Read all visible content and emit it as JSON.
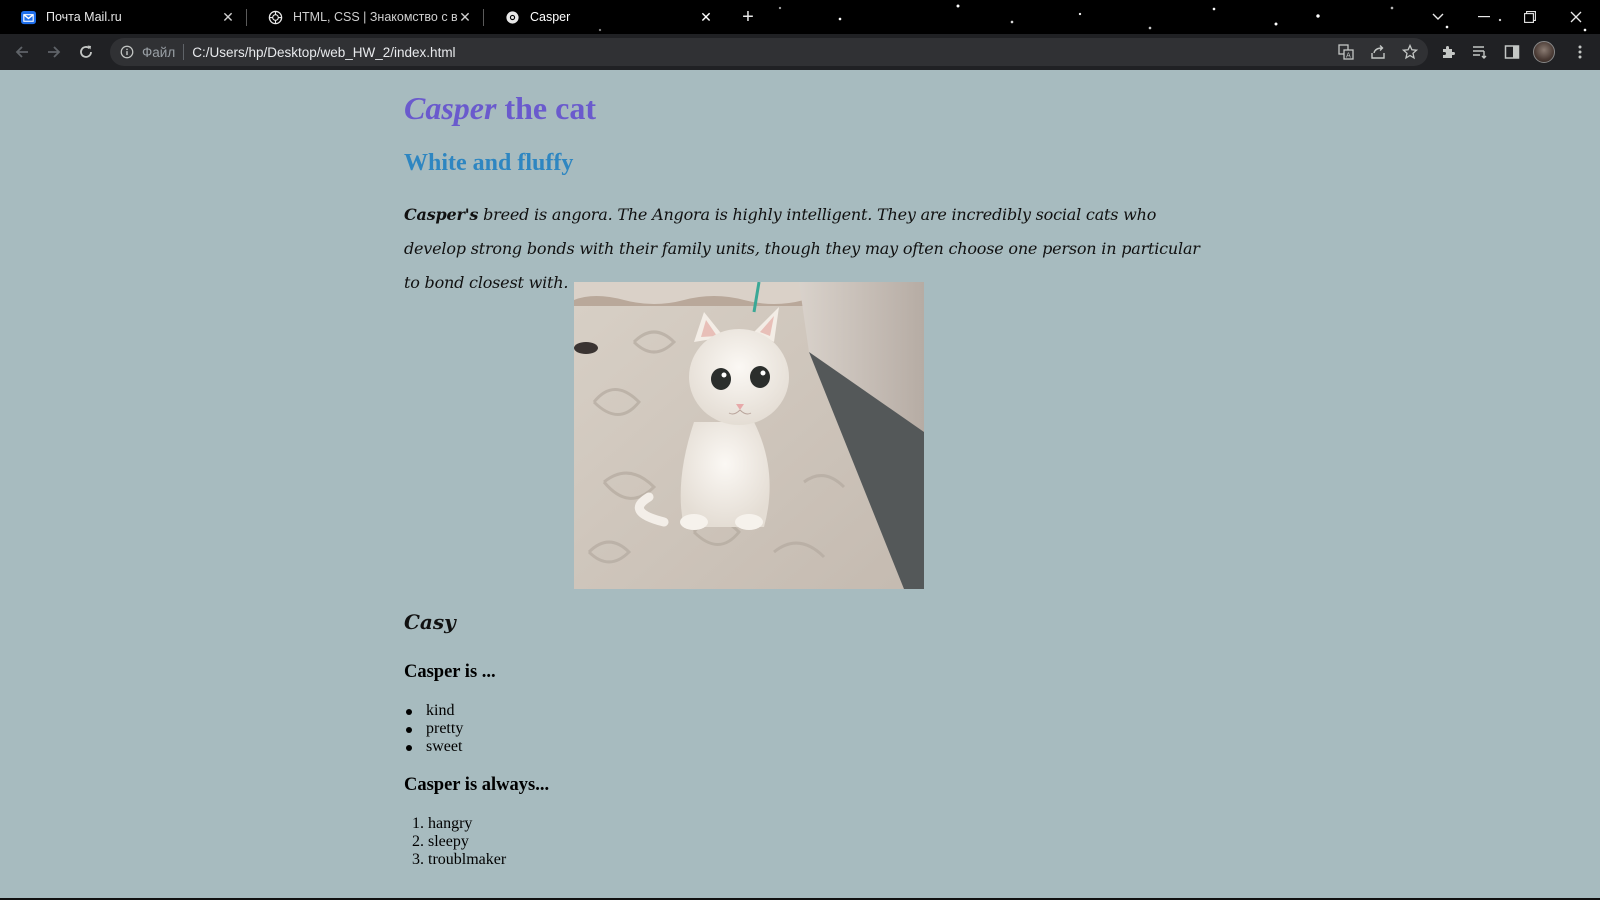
{
  "browser": {
    "tabs": [
      {
        "title": "Почта Mail.ru",
        "icon": "mail-icon"
      },
      {
        "title": "HTML, CSS | Знакомство с веб-т",
        "icon": "openai-icon"
      },
      {
        "title": "Casper",
        "icon": "chrome-page-icon"
      }
    ],
    "address_bar": {
      "scheme_label": "Файл",
      "url": "C:/Users/hp/Desktop/web_HW_2/index.html"
    }
  },
  "page": {
    "title_name": "Casper",
    "title_rest": " the cat",
    "subtitle": "White and fluffy",
    "paragraph_bold": "Casper's",
    "paragraph_text": " breed is angora. The Angora is highly intelligent. They are incredibly social cats who develop strong bonds with their family units, though they may often choose one person in particular to bond closest with.",
    "caption": "Casy",
    "list1_heading": "Casper is ...",
    "list1_items": [
      "kind",
      "pretty",
      "sweet"
    ],
    "list2_heading": "Casper is always...",
    "list2_items": [
      "hangry",
      "sleepy",
      "troublmaker"
    ]
  },
  "colors": {
    "page_background": "#a7bbbf",
    "title": "#6a5acd",
    "subtitle": "#2e86c1"
  }
}
